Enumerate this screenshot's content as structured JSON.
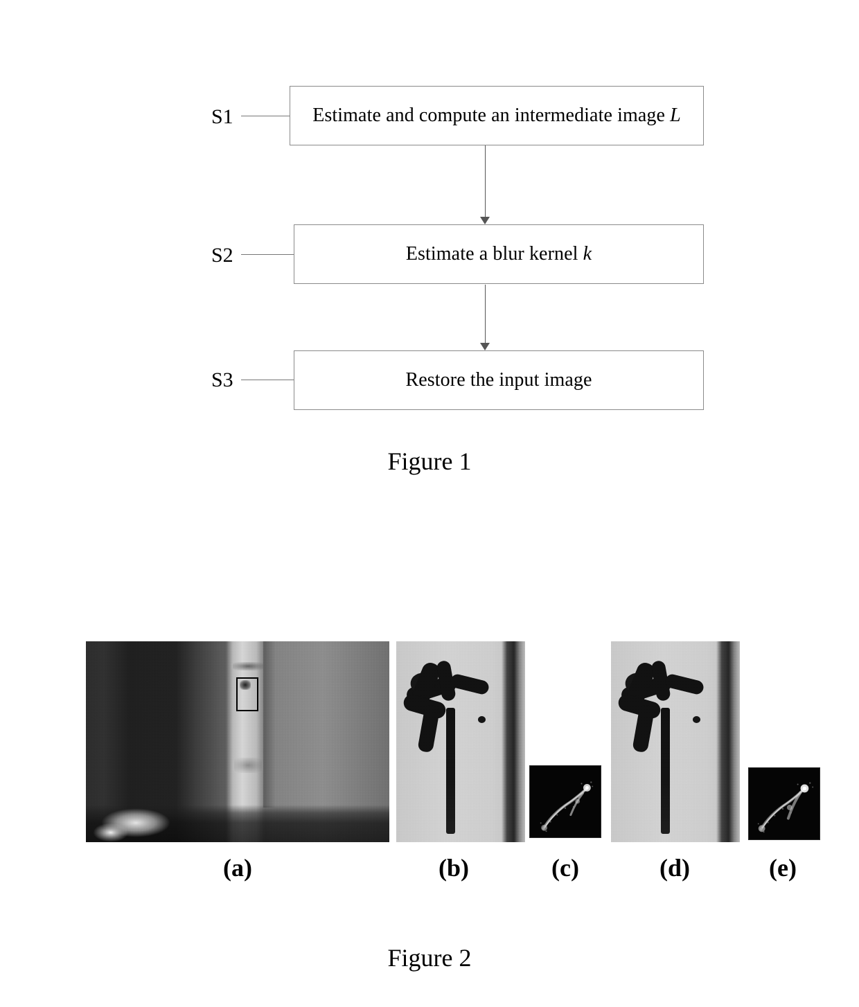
{
  "document": {
    "type": "patent-figure-sheet",
    "page_background": "#ffffff",
    "ink_color": "#000000"
  },
  "figure1": {
    "caption": "Figure 1",
    "type": "flowchart",
    "steps": [
      {
        "tag": "S1",
        "text_before": "Estimate and compute an intermediate image ",
        "italic_symbol": "L",
        "text_after": "",
        "full_text": "Estimate and compute an intermediate image L"
      },
      {
        "tag": "S2",
        "text_before": "Estimate a blur kernel ",
        "italic_symbol": "k",
        "text_after": "",
        "full_text": "Estimate a blur kernel k"
      },
      {
        "tag": "S3",
        "text_before": "Restore the input image",
        "italic_symbol": "",
        "text_after": "",
        "full_text": "Restore the input image"
      }
    ],
    "connectors": [
      {
        "from": "S1",
        "to": "S2",
        "style": "arrow-down"
      },
      {
        "from": "S2",
        "to": "S3",
        "style": "arrow-down"
      }
    ]
  },
  "figure2": {
    "caption": "Figure 2",
    "type": "image-panel-row",
    "panels": [
      {
        "label": "(a)",
        "kind": "photograph",
        "description": "blurry grayscale indoor scene with region-of-interest rectangle",
        "has_roi_marker": true
      },
      {
        "label": "(b)",
        "kind": "image-crop",
        "description": "deblurred calligraphy character crop"
      },
      {
        "label": "(c)",
        "kind": "blur-kernel",
        "description": "estimated blur kernel, white trajectory on black"
      },
      {
        "label": "(d)",
        "kind": "image-crop",
        "description": "deblurred calligraphy character crop"
      },
      {
        "label": "(e)",
        "kind": "blur-kernel",
        "description": "estimated blur kernel, white trajectory on black"
      }
    ]
  }
}
